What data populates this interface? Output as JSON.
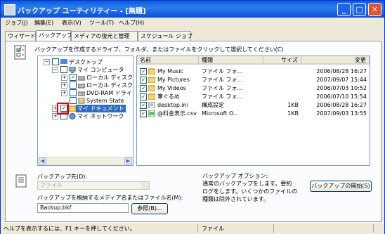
{
  "window": {
    "title": "バックアップ ユーティリティー - [無題]"
  },
  "menu": [
    "ジョブ(J)",
    "編集(E)",
    "表示(V)",
    "ツール(T)",
    "ヘルプ(H)"
  ],
  "tabs": [
    "ウィザード",
    "バックアップ",
    "メディアの復元と管理",
    "スケジュール ジョブ"
  ],
  "instruction": "バックアップを作成するドライブ、フォルダ、またはファイルをクリックして選択してください(C)",
  "tree": {
    "items": [
      "デスクトップ",
      "マイ コンピュータ",
      "ローカル ディスク (C",
      "ローカル ディスク (D",
      "DVD-RAM ドライ",
      "System State",
      "マイ ドキュメント",
      "マイ ネットワーク"
    ]
  },
  "list": {
    "headers": [
      "名前",
      "種類",
      "サイズ",
      "変更"
    ],
    "rows": [
      {
        "name": "My Music",
        "type": "ファイル フォ...",
        "size": "",
        "modified": "2006/08/28 16:27"
      },
      {
        "name": "My Pictures",
        "type": "ファイル フォ...",
        "size": "",
        "modified": "2007/09/07 15:44"
      },
      {
        "name": "My Videos",
        "type": "ファイル フォ...",
        "size": "",
        "modified": "2006/07/03 10:52"
      },
      {
        "name": "筆ぐるめ",
        "type": "ファイル フォ...",
        "size": "",
        "modified": "2006/07/10 15:54"
      },
      {
        "name": "desktop.ini",
        "type": "構成設定",
        "size": "1KB",
        "modified": "2006/08/28 16:27"
      },
      {
        "name": "@料金表示.csv",
        "type": "Microsoft O...",
        "size": "1KB",
        "modified": "2007/09/03 13:55"
      }
    ]
  },
  "backup_dest": {
    "label": "バックアップ先(D):",
    "value": "ファイル"
  },
  "media_name": {
    "label": "バックアップを格納するメディア名またはファイル名(M):",
    "value": "Backup.bkf",
    "browse": "参照(B)..."
  },
  "options": {
    "title": "バックアップ オプション:",
    "text1": "通常のバックアップをします。要約",
    "text2": "ログをします。いくつかのファイルの",
    "text3": "種類は除外されています。"
  },
  "start_button": "バックアップの開始(S)",
  "status": {
    "left": "ヘルプを表示するには、F1 キーを押してください。",
    "right": "ファイル"
  },
  "colors": {
    "title_bar": "#0a5bd6",
    "selection": "#316ac5",
    "highlight_box": "#e00000"
  }
}
